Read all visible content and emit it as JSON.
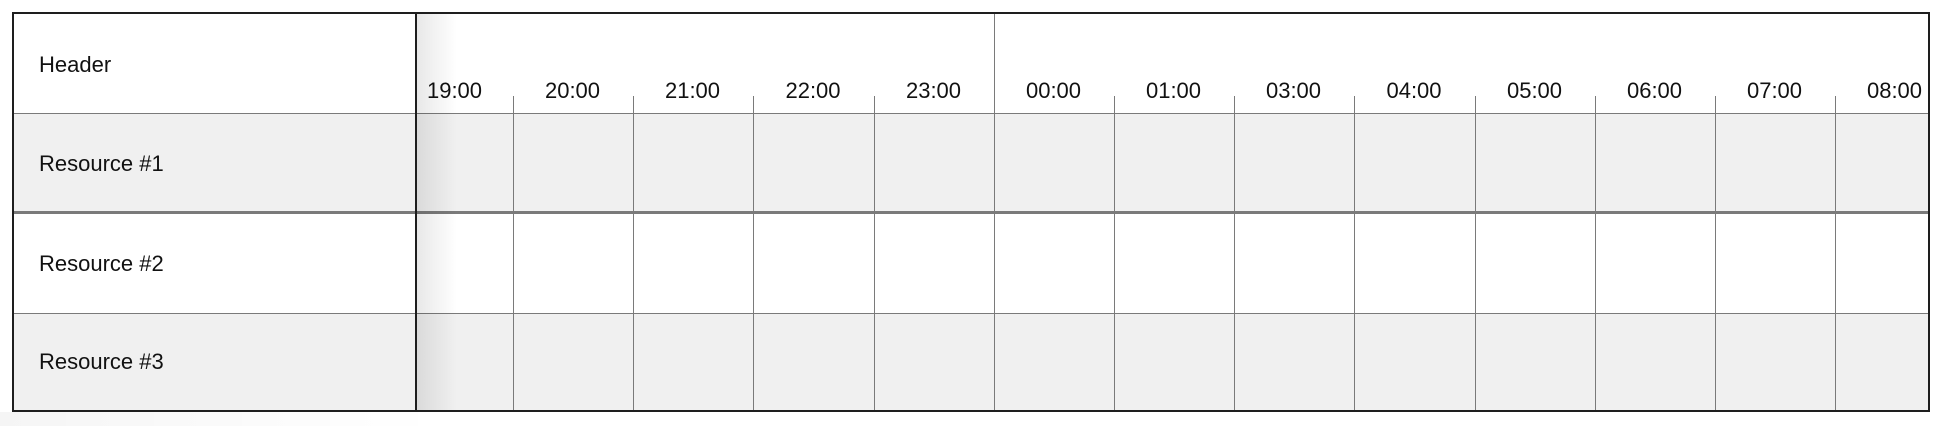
{
  "header": {
    "label": "Header"
  },
  "resources": [
    {
      "label": "Resource #1",
      "background": "#f0f0f0"
    },
    {
      "label": "Resource #2",
      "background": "#ffffff"
    },
    {
      "label": "Resource #3",
      "background": "#f0f0f0"
    }
  ],
  "timeline": {
    "labels": [
      "19:00",
      "20:00",
      "21:00",
      "22:00",
      "23:00",
      "00:00",
      "01:00",
      "03:00",
      "04:00",
      "05:00",
      "06:00",
      "07:00",
      "08:00"
    ]
  },
  "colors": {
    "border": "#1e1e1e",
    "gridline": "#7a7a7a",
    "alt_row": "#f0f0f0"
  }
}
